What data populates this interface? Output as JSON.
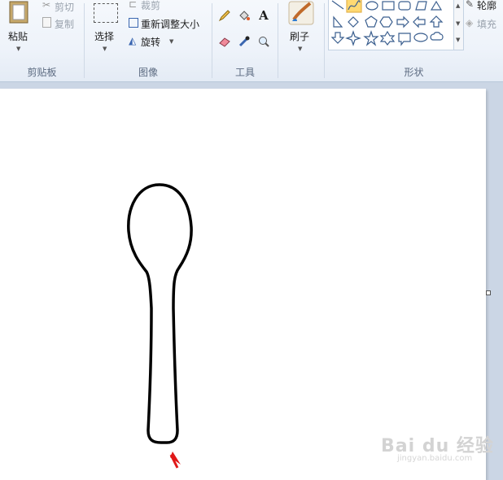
{
  "clipboard": {
    "paste_label": "粘贴",
    "cut_label": "剪切",
    "copy_label": "复制",
    "group_label": "剪贴板"
  },
  "image": {
    "select_label": "选择",
    "crop_label": "裁剪",
    "resize_label": "重新调整大小",
    "rotate_label": "旋转",
    "group_label": "图像"
  },
  "tools": {
    "text_tool_glyph": "A",
    "group_label": "工具"
  },
  "brushes": {
    "label": "刷子"
  },
  "shapes": {
    "group_label": "形状",
    "outline_label": "轮廓",
    "fill_label": "填充",
    "items": [
      "line",
      "curve",
      "oval",
      "rectangle",
      "rounded-rectangle",
      "polygon",
      "triangle",
      "right-triangle",
      "diamond",
      "pentagon",
      "hexagon",
      "right-arrow",
      "left-arrow",
      "up-arrow",
      "down-arrow",
      "four-point-star",
      "five-point-star",
      "six-point-star",
      "rounded-callout",
      "oval-callout",
      "cloud-callout"
    ]
  },
  "watermark": {
    "text": "Bai du 经验",
    "sub": "jingyan.baidu.com"
  },
  "colors": {
    "accent_arrow": "#e01818",
    "selection": "#ffd972"
  }
}
